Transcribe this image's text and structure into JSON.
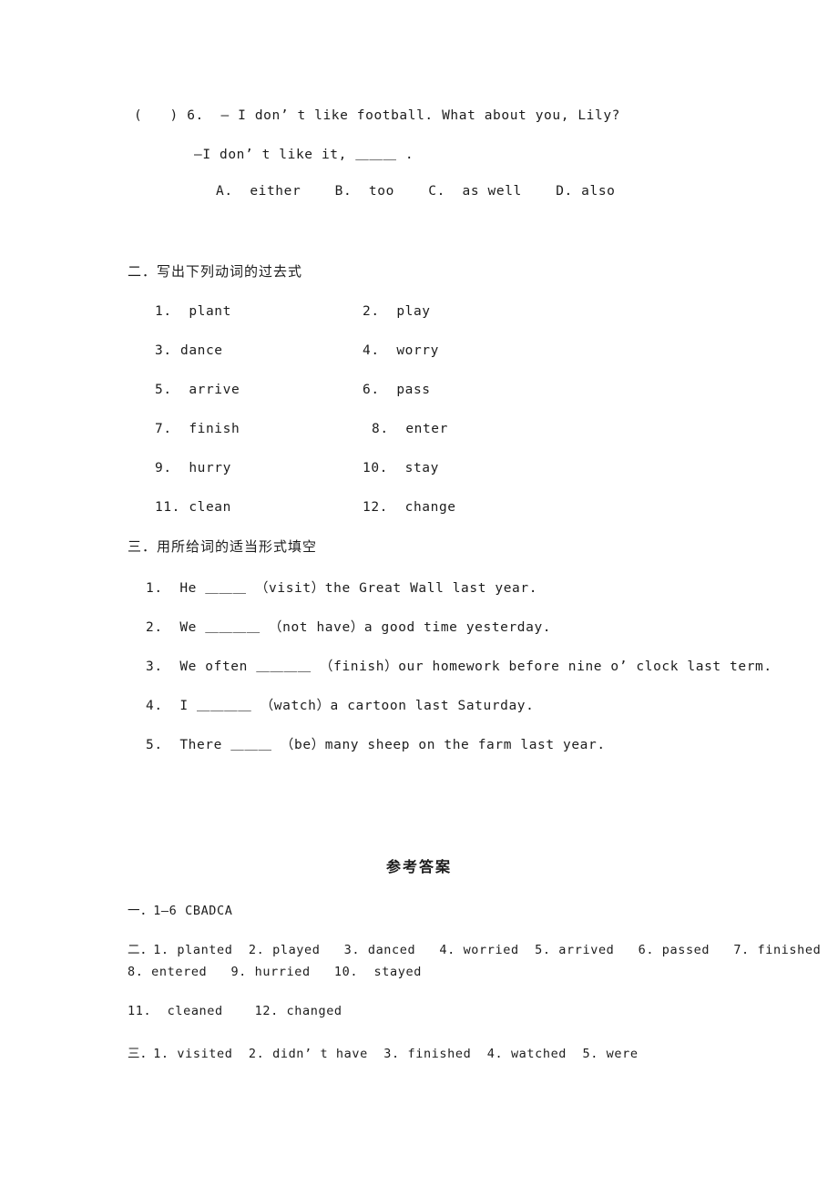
{
  "document": {
    "type": "english-worksheet-with-answer-key",
    "background_color": "#ffffff",
    "text_color": "#1c1c1c"
  },
  "question6": {
    "marker": "(　　) 6.",
    "stem": "(　　) 6.  — I don’ t like football. What about you, Lily?",
    "reply": "—I don’ t like it, ＿＿＿ .",
    "options_line": "A.  either    B.  too    C.  as well    D. also",
    "options": [
      {
        "letter": "A.",
        "text": "either"
      },
      {
        "letter": "B.",
        "text": "too"
      },
      {
        "letter": "C.",
        "text": "as well"
      },
      {
        "letter": "D.",
        "text": "also"
      }
    ]
  },
  "section2": {
    "heading": "二．写出下列动词的过去式",
    "items": [
      {
        "number": "1.",
        "verb": "plant",
        "blank": "＿＿＿＿"
      },
      {
        "number": "2.",
        "verb": "play",
        "blank": "＿＿＿＿"
      },
      {
        "number": "3.",
        "verb": "dance",
        "blank": "＿＿＿＿"
      },
      {
        "number": "4.",
        "verb": "worry",
        "blank": "＿＿＿＿"
      },
      {
        "number": "5.",
        "verb": "arrive",
        "blank": "＿＿＿＿"
      },
      {
        "number": "6.",
        "verb": "pass",
        "blank": "＿＿＿＿"
      },
      {
        "number": "7.",
        "verb": "finish",
        "blank": "＿＿＿＿"
      },
      {
        "number": "8.",
        "verb": "enter",
        "blank": "＿＿＿＿"
      },
      {
        "number": "9.",
        "verb": "hurry",
        "blank": "＿＿＿＿"
      },
      {
        "number": "10.",
        "verb": "stay",
        "blank": "＿＿＿＿"
      },
      {
        "number": "11.",
        "verb": "clean",
        "blank": "＿＿＿＿"
      },
      {
        "number": "12.",
        "verb": "change",
        "blank": "＿＿＿＿"
      }
    ],
    "rows": [
      {
        "left": "1.  plant ",
        "left_blank": "＿＿＿＿",
        "right": "2.  play ",
        "right_blank": "＿＿＿＿"
      },
      {
        "left": "3. dance ",
        "left_blank": "＿＿＿＿",
        "right": "4.  worry ",
        "right_blank": "＿＿＿＿"
      },
      {
        "left": "5.  arrive ",
        "left_blank": "＿＿＿＿",
        "right": "6.  pass ",
        "right_blank": "＿＿＿＿"
      },
      {
        "left": "7.  finish ",
        "left_blank": "＿＿＿＿",
        "right": "8.  enter ",
        "right_blank": "＿＿＿＿"
      },
      {
        "left": "9.  hurry ",
        "left_blank": "＿＿＿＿",
        "right": "10.  stay ",
        "right_blank": "＿＿＿＿"
      },
      {
        "left": "11. clean ",
        "left_blank": "＿＿＿＿",
        "right": "12.  change ",
        "right_blank": "＿＿＿＿"
      }
    ]
  },
  "section3": {
    "heading": "三．用所给词的适当形式填空",
    "items": [
      {
        "number": "1.",
        "text": "1.  He ＿＿＿ （visit）the Great Wall last year."
      },
      {
        "number": "2.",
        "text": "2.  We ＿＿＿＿ （not have）a good time yesterday."
      },
      {
        "number": "3.",
        "text": "3.  We often ＿＿＿＿ （finish）our homework before nine o’ clock last term."
      },
      {
        "number": "4.",
        "text": "4.  I ＿＿＿＿ （watch）a cartoon last Saturday."
      },
      {
        "number": "5.",
        "text": "5.  There ＿＿＿ （be）many sheep on the farm last year."
      }
    ]
  },
  "answer_key": {
    "title": "参考答案",
    "lines": [
      "一．1—6 CBADCA",
      "二．1. planted  2. played   3. danced   4. worried  5. arrived   6. passed   7. finished",
      "8. entered   9. hurried   10.  stayed",
      "11.  cleaned    12. changed",
      "三．1. visited  2. didn’ t have  3. finished  4. watched  5. were"
    ],
    "section1_answers": "1—6 CBADCA",
    "section2_answers": [
      "1. planted",
      "2. played",
      "3. danced",
      "4. worried",
      "5. arrived",
      "6. passed",
      "7. finished",
      "8. entered",
      "9. hurried",
      "10. stayed",
      "11. cleaned",
      "12. changed"
    ],
    "section3_answers": [
      "1. visited",
      "2. didn’ t have",
      "3. finished",
      "4. watched",
      "5. were"
    ]
  }
}
